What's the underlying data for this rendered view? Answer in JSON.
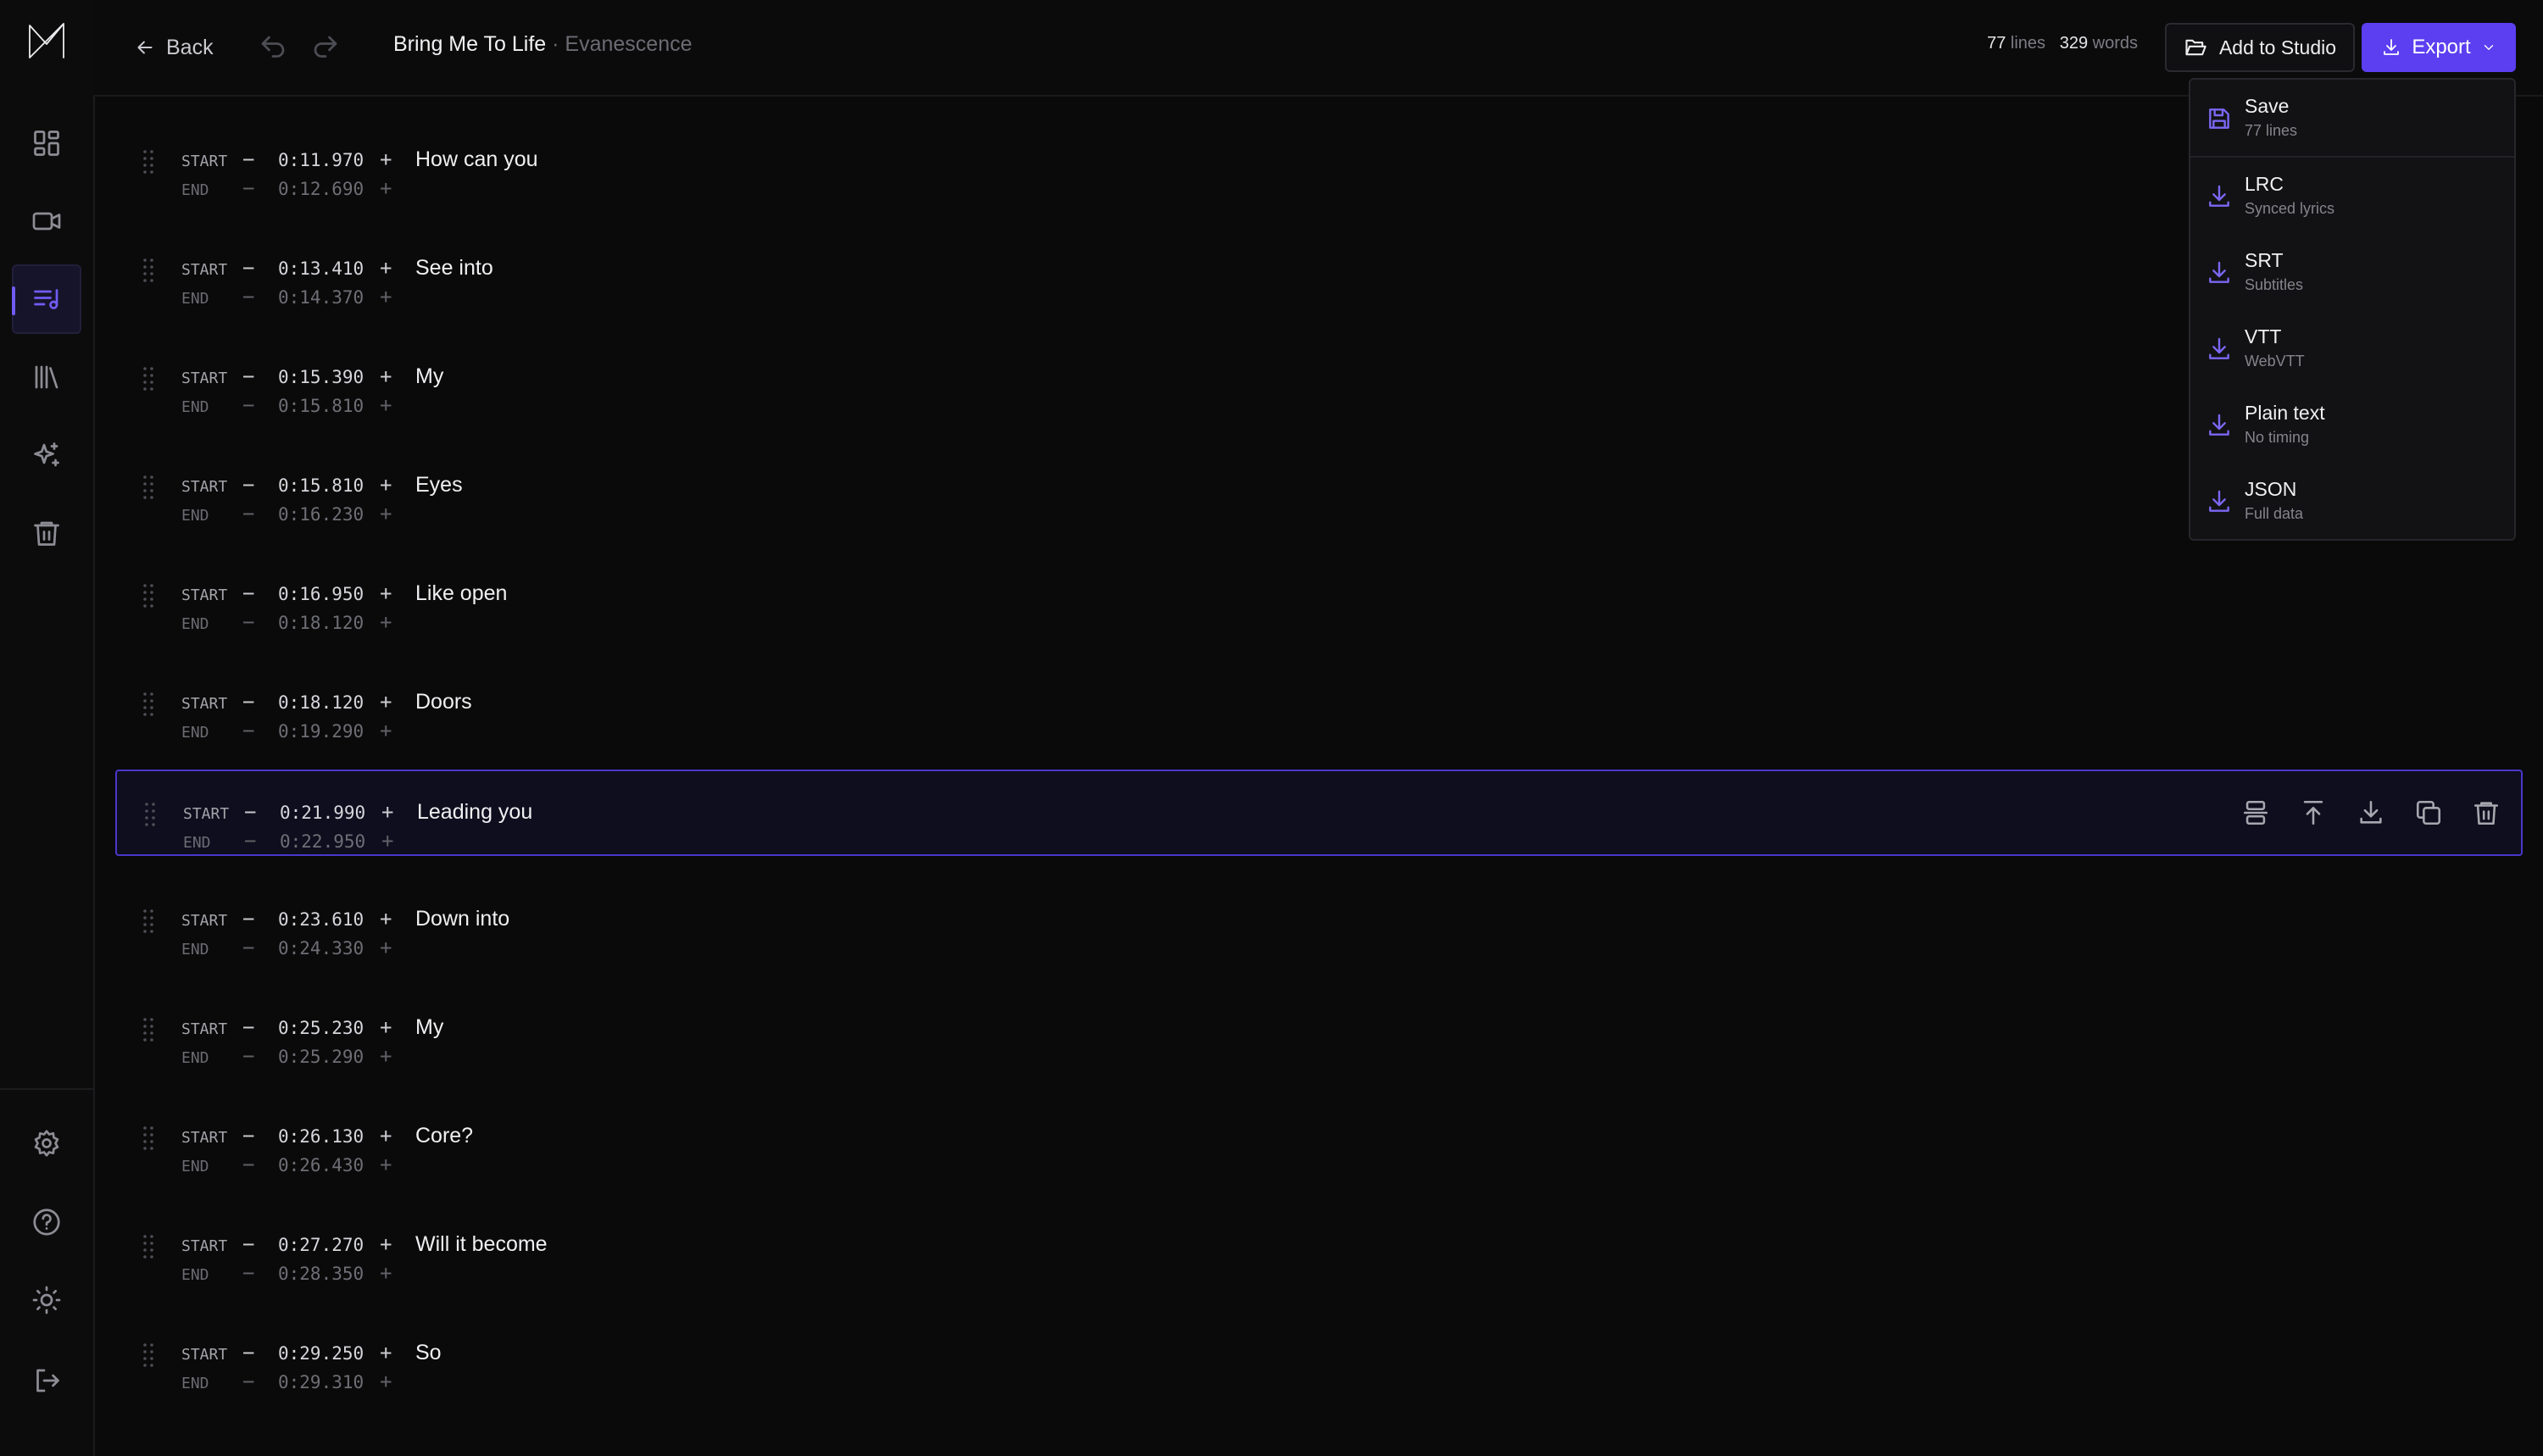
{
  "header": {
    "back_label": "Back",
    "song_title": "Bring Me To Life",
    "artist": " · Evanescence",
    "lines_count": "77",
    "lines_word": "lines",
    "words_count": "329",
    "words_word": "words",
    "add_to_studio_label": "Add to Studio",
    "export_label": "Export"
  },
  "sidebar": {
    "items": [
      "dashboard",
      "video",
      "lyrics-editor",
      "library",
      "ai-tools",
      "trash"
    ],
    "bottom_items": [
      "settings",
      "help",
      "theme",
      "logout"
    ]
  },
  "export_menu": {
    "items": [
      {
        "label": "Save",
        "sub": "77 lines",
        "icon": "save-icon"
      },
      {
        "label": "LRC",
        "sub": "Synced lyrics",
        "icon": "download-icon"
      },
      {
        "label": "SRT",
        "sub": "Subtitles",
        "icon": "download-icon"
      },
      {
        "label": "VTT",
        "sub": "WebVTT",
        "icon": "download-icon"
      },
      {
        "label": "Plain text",
        "sub": "No timing",
        "icon": "download-icon"
      },
      {
        "label": "JSON",
        "sub": "Full data",
        "icon": "download-icon"
      }
    ]
  },
  "labels": {
    "start": "START",
    "end": "END",
    "minus": "−",
    "plus": "+"
  },
  "lines": [
    {
      "start": "0:11.970",
      "end": "0:12.690",
      "text": "How can you"
    },
    {
      "start": "0:13.410",
      "end": "0:14.370",
      "text": "See into"
    },
    {
      "start": "0:15.390",
      "end": "0:15.810",
      "text": "My"
    },
    {
      "start": "0:15.810",
      "end": "0:16.230",
      "text": "Eyes"
    },
    {
      "start": "0:16.950",
      "end": "0:18.120",
      "text": "Like open"
    },
    {
      "start": "0:18.120",
      "end": "0:19.290",
      "text": "Doors"
    },
    {
      "start": "0:21.990",
      "end": "0:22.950",
      "text": "Leading you",
      "selected": true
    },
    {
      "start": "0:23.610",
      "end": "0:24.330",
      "text": "Down into"
    },
    {
      "start": "0:25.230",
      "end": "0:25.290",
      "text": "My"
    },
    {
      "start": "0:26.130",
      "end": "0:26.430",
      "text": "Core?"
    },
    {
      "start": "0:27.270",
      "end": "0:28.350",
      "text": "Will it become"
    },
    {
      "start": "0:29.250",
      "end": "0:29.310",
      "text": "So"
    }
  ],
  "colors": {
    "accent": "#5b3ff0",
    "background": "#0a0a0a",
    "selected_border": "#4a37c9"
  }
}
